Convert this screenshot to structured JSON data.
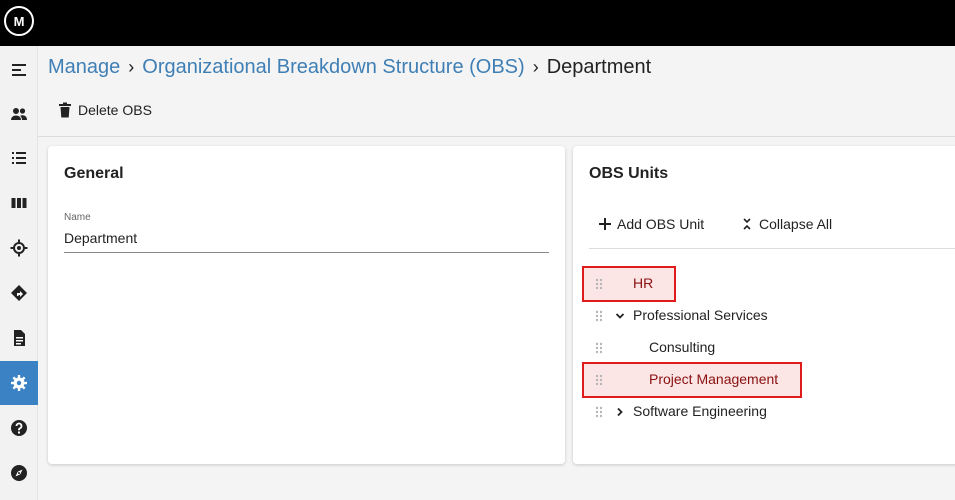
{
  "app": {
    "logo_text": "M",
    "nav_items": [
      {
        "icon": "menu-collapse-icon"
      },
      {
        "icon": "people-icon"
      },
      {
        "icon": "list-icon"
      },
      {
        "icon": "columns-icon"
      },
      {
        "icon": "target-icon"
      },
      {
        "icon": "directions-icon"
      },
      {
        "icon": "document-icon"
      },
      {
        "icon": "gear-icon",
        "active": true
      },
      {
        "icon": "help-icon"
      },
      {
        "icon": "compass-icon"
      }
    ],
    "accent_color": "#3b82c4",
    "highlight_color": "#e01b1b"
  },
  "breadcrumb": {
    "items": [
      "Manage",
      "Organizational Breakdown Structure (OBS)"
    ],
    "current": "Department"
  },
  "toolbar": {
    "delete_label": "Delete OBS"
  },
  "general": {
    "title": "General",
    "name_label": "Name",
    "name_value": "Department"
  },
  "obs_units": {
    "title": "OBS Units",
    "add_label": "Add OBS Unit",
    "collapse_label": "Collapse All",
    "items": [
      {
        "label": "HR",
        "level": 0,
        "expander": "none",
        "highlighted": true
      },
      {
        "label": "Professional Services",
        "level": 0,
        "expander": "expanded",
        "highlighted": false
      },
      {
        "label": "Consulting",
        "level": 1,
        "expander": "none",
        "highlighted": false
      },
      {
        "label": "Project Management",
        "level": 1,
        "expander": "none",
        "highlighted": true
      },
      {
        "label": "Software Engineering",
        "level": 0,
        "expander": "collapsed",
        "highlighted": false
      }
    ]
  }
}
